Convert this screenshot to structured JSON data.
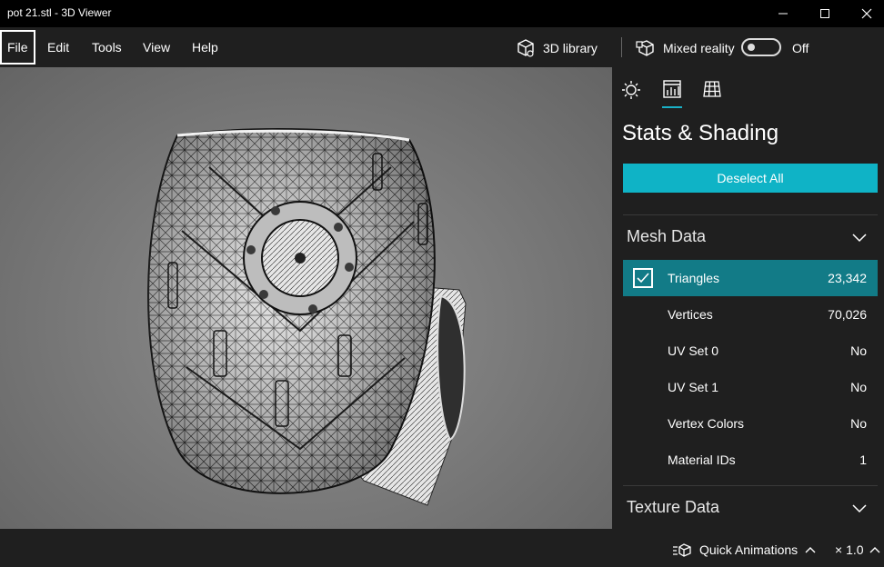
{
  "window": {
    "title": "pot 21.stl - 3D Viewer"
  },
  "menu": {
    "items": [
      {
        "label": "File"
      },
      {
        "label": "Edit"
      },
      {
        "label": "Tools"
      },
      {
        "label": "View"
      },
      {
        "label": "Help"
      }
    ],
    "library_label": "3D library",
    "mixed_reality_label": "Mixed reality",
    "toggle_state": "Off"
  },
  "panel": {
    "tabs": [
      "lighting-icon",
      "stats-icon",
      "grid-icon"
    ],
    "title": "Stats & Shading",
    "deselect_label": "Deselect All",
    "mesh_section": "Mesh Data",
    "mesh_rows": [
      {
        "label": "Triangles",
        "value": "23,342"
      },
      {
        "label": "Vertices",
        "value": "70,026"
      },
      {
        "label": "UV Set 0",
        "value": "No"
      },
      {
        "label": "UV Set 1",
        "value": "No"
      },
      {
        "label": "Vertex Colors",
        "value": "No"
      },
      {
        "label": "Material IDs",
        "value": "1"
      }
    ],
    "texture_section": "Texture Data"
  },
  "bottom": {
    "quick_animations_label": "Quick Animations",
    "speed": "× 1.0"
  },
  "colors": {
    "accent": "#0fb3c6",
    "selected_row": "#127b87"
  }
}
